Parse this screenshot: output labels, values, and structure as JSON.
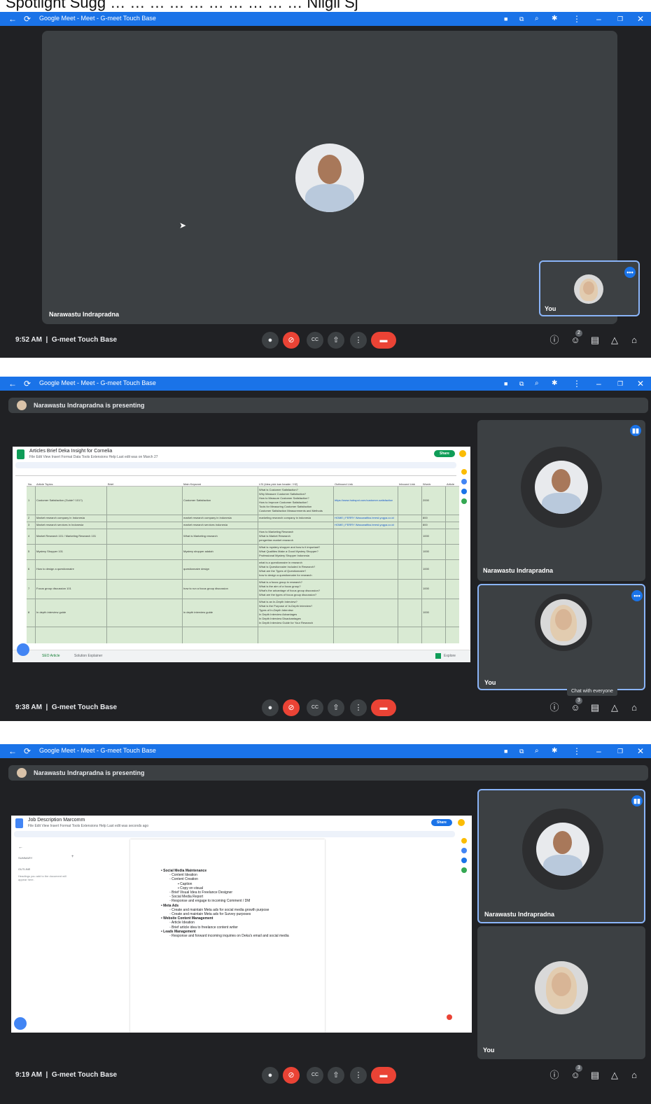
{
  "caption_crop": "Spotlight Sugg  … … … … … … … … … … Nilgii Sj",
  "panels": [
    {
      "window_title": "Google Meet - Meet - G-meet Touch Base",
      "main_participant": "Narawastu Indrapradna",
      "self_label": "You",
      "time": "9:52 AM",
      "meeting_name": "G-meet Touch Base",
      "participants_count": "2"
    },
    {
      "window_title": "Google Meet - Meet - G-meet Touch Base",
      "presenting_text": "Narawastu Indrapradna is presenting",
      "doc_title": "Articles Brief Deka Insight for Cornelia",
      "doc_menu": "File  Edit  View  Insert  Format  Data  Tools  Extensions  Help   Last edit was on March 27",
      "share_label": "Share",
      "sheet_headers": [
        "No.",
        "Article Topics",
        "Brief",
        "Main Keyword",
        "LSI (Idea pick kan header / H2)",
        "Outbound Link",
        "Inbound Link",
        "Words",
        "Article"
      ],
      "sheet_rows": [
        {
          "no": "1",
          "topic": "Customer Satisfaction (Guide? 101?)",
          "keyword": "Customer Satisfaction",
          "lsi": [
            "What is Customer Satisfaction?",
            "Why Measure Customer Satisfaction?",
            "How to Measure Customer Satisfaction?",
            "How to Improve Customer Satisfaction?",
            "Tools for Measuring Customer Satisfaction",
            "Customer Satisfaction Measurements and Methods"
          ],
          "outbound": "https://www.hubspot.com/customer-satisfaction",
          "words": "2000"
        },
        {
          "no": "2",
          "topic": "Market research company in Indonesia",
          "keyword": "market research company in indonesia",
          "lsi": [
            "marketing research company in indonesia"
          ],
          "outbound": "HOME | FERRY Wasowatifus.terest.yogya.co.id",
          "words": "800"
        },
        {
          "no": "3",
          "topic": "Market research services in Indonesia",
          "keyword": "market research services indonesia",
          "lsi": [],
          "outbound": "HOME | FERRY Wasowatifus.terest.yogya.co.id",
          "words": "800"
        },
        {
          "no": "4",
          "topic": "Market Research 101 / Marketing Research 101",
          "keyword": "What is Marketing research",
          "lsi": [
            "How to Marketing Research",
            "What is Market Research",
            "pengertian market research"
          ],
          "outbound": "",
          "words": "1000"
        },
        {
          "no": "5",
          "topic": "Mystery Shopper 101",
          "keyword": "Mystery shopper adalah",
          "lsi": [
            "What is mystery shopper and how is it important?",
            "What Qualities Make a Good Mystery Shopper?",
            "Professional Mystery Shopper Indonesia"
          ],
          "outbound": "",
          "words": "1000"
        },
        {
          "no": "6",
          "topic": "How to design a questionnaire",
          "keyword": "questionnaire design",
          "lsi": [
            "what is a questionnaire in research",
            "What is Questionnaire Included in Research?",
            "What are the Types of Questionnaire?",
            "how to design a questionnaire for research"
          ],
          "outbound": "",
          "words": "1000"
        },
        {
          "no": "7",
          "topic": "Focus group discussion 101",
          "keyword": "how to run a focus group discussion",
          "lsi": [
            "What is a focus group in research?",
            "What is the aim of a focus group?",
            "What's the advantage of focus group discussion?",
            "What are the types of focus group discussion?"
          ],
          "outbound": "",
          "words": "1000"
        },
        {
          "no": "8",
          "topic": "In depth interview guide",
          "keyword": "in depth interview guide",
          "lsi": [
            "What is an In-Depth Interview?",
            "What is the Purpose of In-Depth Interview?",
            "Types of In-Depth Interview",
            "In Depth Interview Advantages",
            "In Depth Interview Disadvantages",
            "In Depth Interview Guide for Your Research"
          ],
          "outbound": "",
          "words": "1000"
        }
      ],
      "sheet_tabs": [
        "SEO Article",
        "Solution Explainer"
      ],
      "explore_label": "Explore",
      "side_participant": "Narawastu Indrapradna",
      "self_label": "You",
      "tooltip": "Chat with everyone",
      "time": "9:38 AM",
      "meeting_name": "G-meet Touch Base",
      "participants_count": "3"
    },
    {
      "window_title": "Google Meet - Meet - G-meet Touch Base",
      "presenting_text": "Narawastu Indrapradna is presenting",
      "doc_title": "Job Description Marcomm",
      "doc_menu": "File  Edit  View  Insert  Format  Tools  Extensions  Help   Last edit was seconds ago",
      "share_label": "Share",
      "outline_summary": "SUMMARY",
      "outline_title": "OUTLINE",
      "outline_hint": "Headings you add to the document will appear here.",
      "bullets": [
        {
          "level": 1,
          "text": "Social Media Maintenance"
        },
        {
          "level": 2,
          "text": "Content Ideation"
        },
        {
          "level": 2,
          "text": "Content Creation"
        },
        {
          "level": 3,
          "text": "Caption"
        },
        {
          "level": 3,
          "text": "Copy on visual"
        },
        {
          "level": 2,
          "text": "Brief Visual Idea to Freelance Designer"
        },
        {
          "level": 2,
          "text": "Social Media Report"
        },
        {
          "level": 2,
          "text": "Response and engage to incoming Comment / DM"
        },
        {
          "level": 1,
          "text": "Meta Ads"
        },
        {
          "level": 2,
          "text": "Create and maintain Meta ads for social media growth purpose"
        },
        {
          "level": 2,
          "text": "Create and maintain Meta ads for Survey purposes"
        },
        {
          "level": 1,
          "text": "Website Content Management"
        },
        {
          "level": 2,
          "text": "Article Ideation"
        },
        {
          "level": 2,
          "text": "Brief article idea to freelance content writer"
        },
        {
          "level": 1,
          "text": "Leads Management"
        },
        {
          "level": 2,
          "text": "Response and forward incoming inquiries on Deka's email and social media"
        }
      ],
      "side_participant": "Narawastu Indrapradna",
      "self_label": "You",
      "time": "9:19 AM",
      "meeting_name": "G-meet Touch Base",
      "participants_count": "3"
    }
  ],
  "colors": {
    "titlebar": "#1a73e8",
    "meet_bg": "#202124",
    "tile_bg": "#3c4043",
    "hangup": "#ea4335",
    "sheet_green": "#d9ead3",
    "selected_border": "#8ab4f8"
  },
  "icons": {
    "back": "←",
    "reload": "⟳",
    "mic": "🎤",
    "camera_off": "⊘",
    "captions": "CC",
    "present": "⇧",
    "more": "⋮",
    "hangup": "☎",
    "info": "ⓘ",
    "people": "👥",
    "chat": "▤",
    "activities": "△",
    "lock": "🔒"
  }
}
